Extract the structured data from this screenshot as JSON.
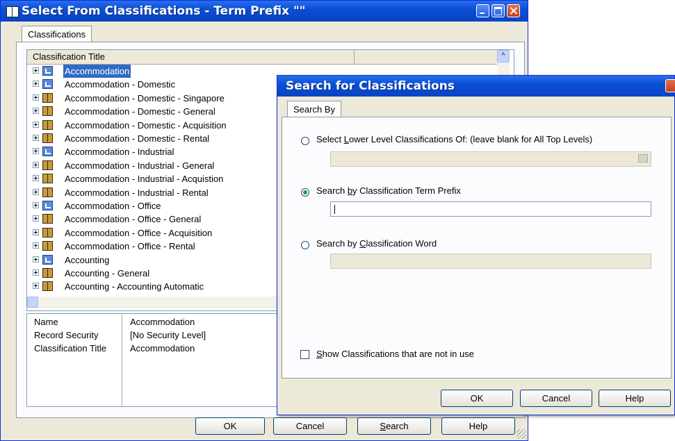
{
  "main_window": {
    "title": "Select From Classifications - Term Prefix \"\"",
    "tab_label": "Classifications",
    "column_header": "Classification Title",
    "rows": [
      {
        "label": "Accommodation",
        "icon": "folder-link-icon",
        "selected": true
      },
      {
        "label": "Accommodation - Domestic",
        "icon": "folder-link-icon"
      },
      {
        "label": "Accommodation - Domestic - Singapore",
        "icon": "book-icon"
      },
      {
        "label": "Accommodation - Domestic - General",
        "icon": "book-icon"
      },
      {
        "label": "Accommodation - Domestic - Acquisition",
        "icon": "book-icon"
      },
      {
        "label": "Accommodation - Domestic - Rental",
        "icon": "book-icon"
      },
      {
        "label": "Accommodation - Industrial",
        "icon": "folder-link-icon"
      },
      {
        "label": "Accommodation - Industrial - General",
        "icon": "book-icon"
      },
      {
        "label": "Accommodation - Industrial - Acquistion",
        "icon": "book-icon"
      },
      {
        "label": "Accommodation - Industrial - Rental",
        "icon": "book-icon"
      },
      {
        "label": "Accommodation - Office",
        "icon": "folder-link-icon"
      },
      {
        "label": "Accommodation - Office - General",
        "icon": "book-icon"
      },
      {
        "label": "Accommodation - Office - Acquisition",
        "icon": "book-icon"
      },
      {
        "label": "Accommodation - Office - Rental",
        "icon": "book-icon"
      },
      {
        "label": "Accounting",
        "icon": "folder-link-icon"
      },
      {
        "label": "Accounting - General",
        "icon": "book-icon"
      },
      {
        "label": "Accounting - Accounting Automatic",
        "icon": "book-icon"
      }
    ],
    "properties": [
      {
        "key": "Name",
        "value": "Accommodation"
      },
      {
        "key": "Record Security",
        "value": "[No Security Level]"
      },
      {
        "key": "Classification Title",
        "value": "Accommodation"
      }
    ],
    "buttons": {
      "ok": "OK",
      "cancel": "Cancel",
      "search_pre": "",
      "search_u": "S",
      "search_post": "earch",
      "help": "Help"
    }
  },
  "search_dialog": {
    "title": "Search for Classifications",
    "tab_label": "Search By",
    "option1": {
      "pre": "Select ",
      "u": "L",
      "post": "ower Level Classifications Of: (leave blank for All Top Levels)",
      "checked": false
    },
    "option2": {
      "pre": "Search ",
      "u": "b",
      "post": "y Classification Term Prefix",
      "checked": true,
      "value": ""
    },
    "option3": {
      "pre": "Search by ",
      "u": "C",
      "post": "lassification Word",
      "checked": false
    },
    "show_unused": {
      "pre": "",
      "u": "S",
      "post": "how Classifications that are not in use",
      "checked": false
    },
    "buttons": {
      "ok": "OK",
      "cancel": "Cancel",
      "help": "Help"
    }
  },
  "colors": {
    "titlebar": "#0a4fd6",
    "selection": "#316ac5",
    "dialog_bg": "#ece9d8"
  }
}
